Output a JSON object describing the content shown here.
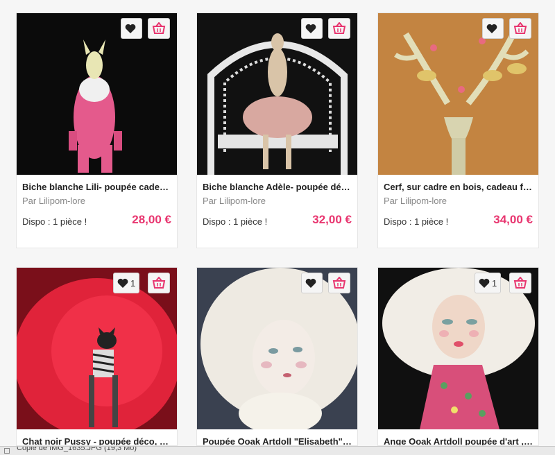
{
  "products": [
    {
      "title": "Biche blanche Lili- poupée cadeau ...",
      "author": "Par Lilipom-lore",
      "availability": "Dispo : 1 pièce !",
      "price": "28,00 €",
      "like_count": "",
      "image": "pink-doe-doll-photo"
    },
    {
      "title": "Biche blanche Adèle- poupée déco...",
      "author": "Par Lilipom-lore",
      "availability": "Dispo : 1 pièce !",
      "price": "32,00 €",
      "like_count": "",
      "image": "doe-doll-on-wicker-chair-photo"
    },
    {
      "title": "Cerf, sur cadre en bois, cadeau fêt...",
      "author": "Par Lilipom-lore",
      "availability": "Dispo : 1 pièce !",
      "price": "34,00 €",
      "like_count": "",
      "image": "stag-head-on-wood-photo"
    },
    {
      "title": "Chat noir Pussy - poupée déco, cad...",
      "author": "",
      "availability": "",
      "price": "",
      "like_count": "1",
      "image": "black-cat-doll-in-red-box-photo"
    },
    {
      "title": "Poupée Ooak Artdoll \"Elisabeth\" p...",
      "author": "",
      "availability": "",
      "price": "",
      "like_count": "",
      "image": "white-haired-art-doll-photo"
    },
    {
      "title": "Ange Ooak Artdoll poupée d'art , c...",
      "author": "",
      "availability": "",
      "price": "",
      "like_count": "1",
      "image": "angel-art-doll-photo"
    }
  ],
  "icons": {
    "like": "heart-icon",
    "basket": "basket-icon"
  },
  "colors": {
    "accent": "#e8356f",
    "like": "#222222"
  },
  "statusbar": {
    "text": "Copie de IMG_1635.JPG (19,3 Mo)"
  }
}
